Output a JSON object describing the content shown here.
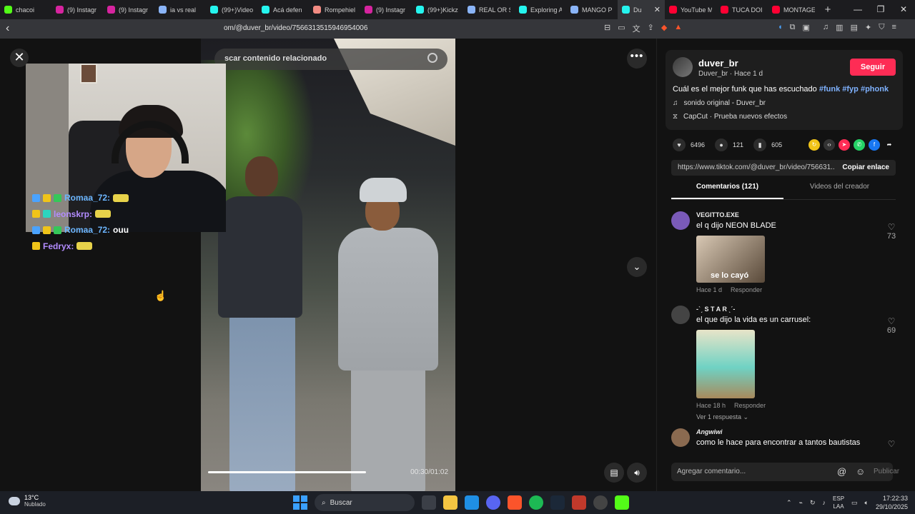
{
  "tabs": [
    {
      "label": "chacoi",
      "color": "#53fc18"
    },
    {
      "label": "(9) Instagr",
      "color": "#d6249f"
    },
    {
      "label": "(9) Instagr",
      "color": "#d6249f"
    },
    {
      "label": "ia vs real",
      "color": "#8ab4f8"
    },
    {
      "label": "(99+)Video",
      "color": "#25f4ee"
    },
    {
      "label": "Acá defen",
      "color": "#25f4ee"
    },
    {
      "label": "Rompehiel",
      "color": "#f28b82"
    },
    {
      "label": "(9) Instagr",
      "color": "#d6249f"
    },
    {
      "label": "(99+)Kickz",
      "color": "#25f4ee"
    },
    {
      "label": "REAL OR S",
      "color": "#8ab4f8"
    },
    {
      "label": "Exploring A",
      "color": "#25f4ee"
    },
    {
      "label": "MANGO P",
      "color": "#8ab4f8"
    },
    {
      "label": "Du",
      "color": "#25f4ee",
      "active": true
    },
    {
      "label": "YouTube M",
      "color": "#ff0033"
    },
    {
      "label": "TUCA DOI",
      "color": "#ff0033"
    },
    {
      "label": "MONTAGE",
      "color": "#ff0033"
    }
  ],
  "new_tab": "+",
  "window_controls": {
    "minimize": "—",
    "maximize": "❐",
    "close": "✕"
  },
  "address": {
    "url": "om/@duver_br/video/7566313515946954006",
    "back": "‹"
  },
  "video_page": {
    "search_placeholder": "scar contenido relacionado",
    "close": "✕",
    "more": "•••",
    "down": "⌄",
    "time": "00:30/01:02",
    "progress": 0.65
  },
  "chat": [
    {
      "user": "Romaa_72:",
      "msg": "",
      "color": "#6cb6ff",
      "badges": [
        "#4aa3ff",
        "#f0c419",
        "#35c759"
      ]
    },
    {
      "user": "leonskrp:",
      "msg": "",
      "color": "#b38cff",
      "badges": [
        "#f0c419",
        "#2dd4bf"
      ]
    },
    {
      "user": "Romaa_72:",
      "msg": "ouu",
      "color": "#6cb6ff",
      "badges": [
        "#4aa3ff",
        "#f0c419",
        "#35c759"
      ]
    },
    {
      "user": "Fedryx:",
      "msg": "",
      "color": "#b38cff",
      "badges": [
        "#f0c419"
      ]
    }
  ],
  "creator": {
    "name": "duver_br",
    "sub": "Duver_br · Hace 1 d",
    "follow": "Seguir",
    "desc": "Cuál es el mejor funk que has escuchado",
    "tags": [
      "#funk",
      "#fyp",
      "#phonk"
    ],
    "music": "sonido original - Duver_br",
    "effect": "CapCut · Prueba nuevos efectos"
  },
  "stats": {
    "likes": "6496",
    "comments": "121",
    "saves": "605"
  },
  "link": {
    "url": "https://www.tiktok.com/@duver_br/video/756631...",
    "copy": "Copiar enlace"
  },
  "panel_tabs": [
    "Comentarios (121)",
    "Videos del creador"
  ],
  "comments": [
    {
      "user": "VEGITTO.EXE",
      "text": "el q dijo NEON BLADE",
      "likes": "73",
      "meta": "Hace 1 d",
      "reply": "Responder",
      "img_text": "se lo cayó"
    },
    {
      "user": "-ˋˏ S T A R ˎˊ-",
      "text": "el que dijo la vida es un carrusel:",
      "likes": "69",
      "meta": "Hace 18 h",
      "reply": "Responder",
      "more": "Ver 1 respuesta ⌄"
    },
    {
      "user": "Angwiwi",
      "text": "como le hace para encontrar a tantos bautistas",
      "likes": ""
    }
  ],
  "composer": {
    "placeholder": "Agregar comentario...",
    "at": "@",
    "emoji": "☺",
    "publish": "Publicar"
  },
  "taskbar": {
    "temp": "13°C",
    "weather": "Nublado",
    "search": "Buscar",
    "lang1": "ESP",
    "lang2": "LAA",
    "time": "17:22:33",
    "date": "29/10/2025"
  }
}
